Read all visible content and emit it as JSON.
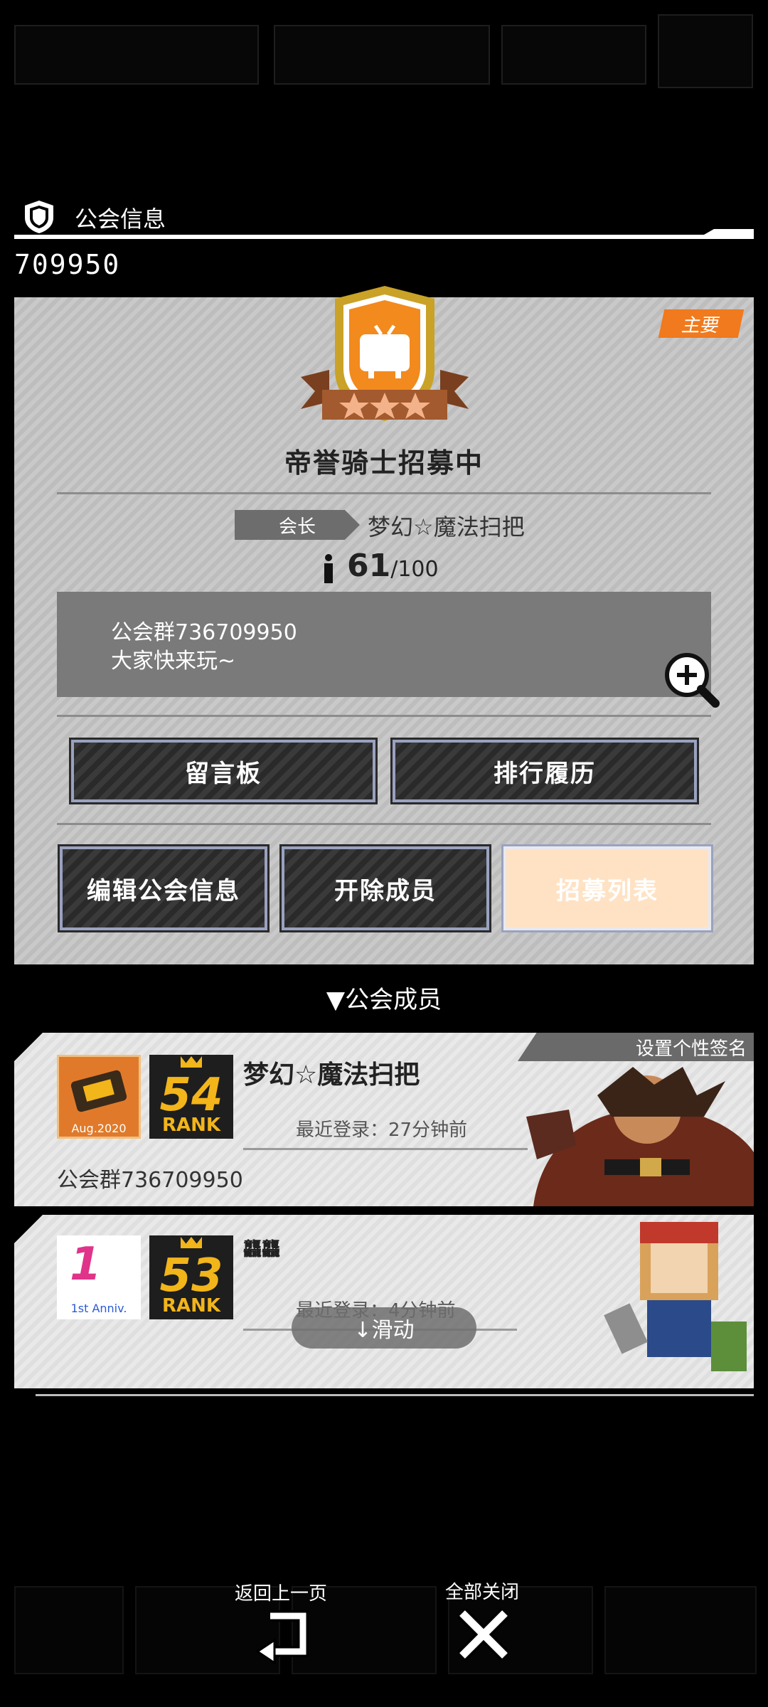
{
  "section": {
    "title": "公会信息",
    "guild_id": "709950"
  },
  "guild": {
    "tag_main": "主要",
    "recruit_title": "帝誉骑士招募中",
    "leader_label": "会长",
    "leader_name": "梦幻☆魔法扫把",
    "member_count": "61",
    "member_max": "/100",
    "description": [
      "公会群736709950",
      "大家快来玩~"
    ]
  },
  "buttons": {
    "message_board": "留言板",
    "ranking_history": "排行履历",
    "edit_info": "编辑公会信息",
    "remove_member": "开除成员",
    "recruit_list": "招募列表"
  },
  "members": {
    "header": "▼公会成员",
    "set_signature": "设置个性签名",
    "list": [
      {
        "badge": "Aug.2020",
        "rank": "54",
        "rank_label": "RANK",
        "name": "梦幻☆魔法扫把",
        "last_login": "最近登录：27分钟前",
        "signature": "公会群736709950"
      },
      {
        "badge": "1st Anniv.",
        "rank": "53",
        "rank_label": "RANK",
        "name": "龘龘",
        "last_login": "最近登录：4分钟前",
        "signature": ""
      }
    ]
  },
  "swipe_hint": "↓滑动",
  "nav": {
    "back": "返回上一页",
    "close_all": "全部关闭"
  },
  "colors": {
    "accent_orange": "#f07a1d",
    "emblem_gold": "#c9a227",
    "emblem_orange": "#f28a1e",
    "rank_gold": "#f2b51a",
    "recruit_button": "#ffe2c4"
  },
  "icons": [
    "shield-icon",
    "tv-icon",
    "person-icon",
    "zoom-in-icon",
    "back-arrow-icon",
    "close-x-icon"
  ]
}
